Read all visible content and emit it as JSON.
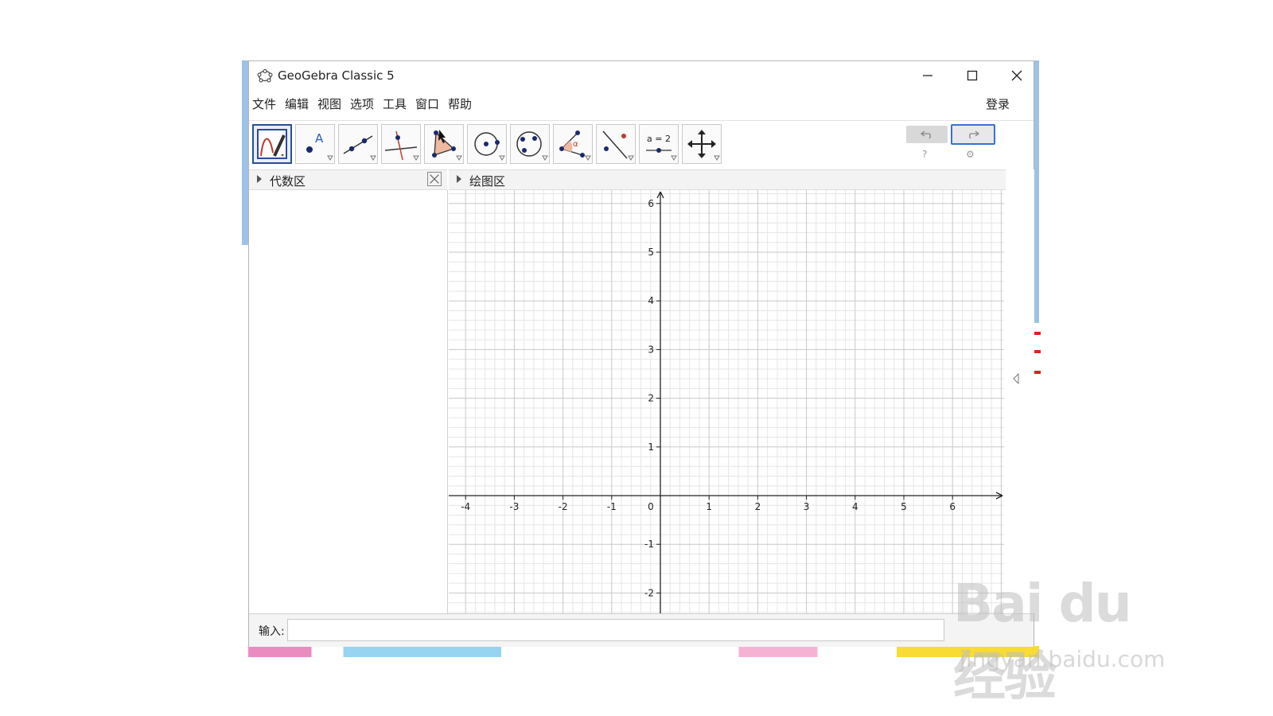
{
  "window": {
    "title": "GeoGebra Classic 5",
    "controls": {
      "minimize": "minimize",
      "maximize": "maximize",
      "close": "close"
    }
  },
  "menu": {
    "items": [
      "文件",
      "编辑",
      "视图",
      "选项",
      "工具",
      "窗口",
      "帮助"
    ],
    "login": "登录"
  },
  "toolbar": {
    "tools": [
      {
        "name": "move-graphics-pen-icon"
      },
      {
        "name": "point-icon",
        "label": "A"
      },
      {
        "name": "line-icon"
      },
      {
        "name": "perpendicular-line-icon"
      },
      {
        "name": "polygon-icon"
      },
      {
        "name": "circle-center-point-icon"
      },
      {
        "name": "circle-three-points-icon"
      },
      {
        "name": "angle-icon",
        "label": "α"
      },
      {
        "name": "reflect-icon"
      },
      {
        "name": "slider-icon",
        "label": "a = 2"
      },
      {
        "name": "move-view-icon"
      }
    ]
  },
  "panels": {
    "algebra": {
      "title": "代数区"
    },
    "graphics": {
      "title": "绘图区"
    }
  },
  "graph": {
    "x_ticks": [
      "-4",
      "-3",
      "-2",
      "-1",
      "0",
      "1",
      "2",
      "3",
      "4",
      "5",
      "6"
    ],
    "y_ticks": [
      "6",
      "5",
      "4",
      "3",
      "2",
      "1",
      "-1",
      "-2"
    ]
  },
  "input": {
    "label": "输入:",
    "value": ""
  },
  "watermark": {
    "main": "Bai du 经验",
    "sub": "jingyan.baidu.com"
  },
  "colors": {
    "accent": "#2a4c9a",
    "grid_major": "#c8c8c8",
    "grid_minor": "#e6e6e6",
    "alert": "#e02020"
  }
}
